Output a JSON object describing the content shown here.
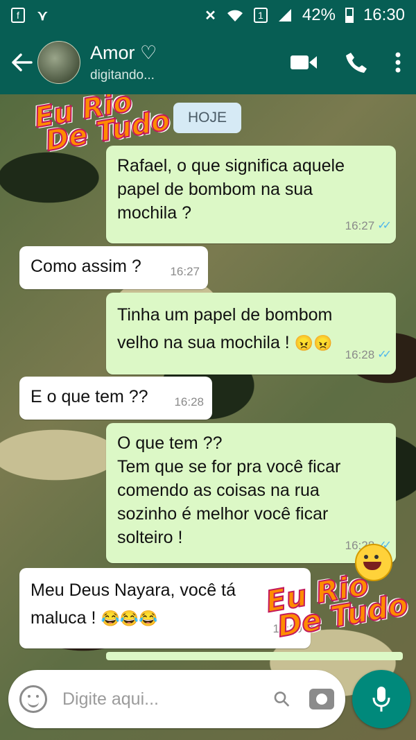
{
  "status_bar": {
    "left_icons": [
      "facebook-icon",
      "notification-icon"
    ],
    "sim": "1",
    "battery": "42%",
    "time": "16:30"
  },
  "header": {
    "contact_name": "Amor ♡",
    "status": "digitando..."
  },
  "chat": {
    "date_chip": "HOJE",
    "messages": [
      {
        "dir": "out",
        "text": "Rafael, o que significa aquele\npapel de bombom na sua\nmochila ?",
        "time": "16:27",
        "read": true
      },
      {
        "dir": "in",
        "text": "Como assim ?",
        "time": "16:27"
      },
      {
        "dir": "out",
        "text": "Tinha um papel de bombom\nvelho na sua mochila !",
        "emoji": "😠😠",
        "time": "16:28",
        "read": true
      },
      {
        "dir": "in",
        "text": "E o que tem ??",
        "time": "16:28"
      },
      {
        "dir": "out",
        "text": "O que tem ??\nTem que se for pra você ficar\ncomendo as coisas na rua\nsozinho é melhor você ficar\nsolteiro !",
        "time": "16:28",
        "read": true
      },
      {
        "dir": "in",
        "text": "Meu Deus Nayara, você tá\nmaluca !",
        "emoji": "😂😂😂",
        "time": "16:29"
      }
    ]
  },
  "composer": {
    "placeholder": "Digite aqui..."
  },
  "watermark": {
    "line1": "Eu Rio",
    "line2": "De Tudo"
  },
  "colors": {
    "header": "#075e54",
    "outgoing_bubble": "#dcf8c6",
    "incoming_bubble": "#ffffff",
    "read_ticks": "#4fb6ec",
    "mic_button": "#00897b"
  }
}
